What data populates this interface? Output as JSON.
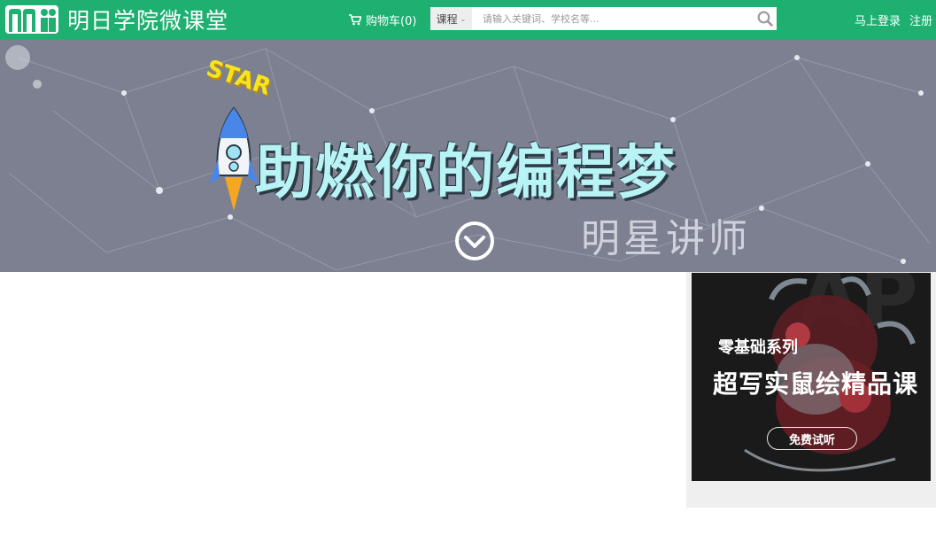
{
  "header": {
    "site_name": "明日学院微课堂",
    "cart_label": "购物车(0)",
    "search": {
      "type_label": "课程",
      "placeholder": "请输入关键词、学校名等..."
    },
    "login_label": "马上登录",
    "register_label": "注册"
  },
  "banner": {
    "star_text": "STAR",
    "title": "助燃你的编程梦",
    "subtitle": "明星讲师"
  },
  "ad": {
    "subtitle": "零基础系列",
    "title": "超写实鼠绘精品课",
    "button_label": "免费试听"
  },
  "colors": {
    "brand_green": "#1db071",
    "banner_bg": "#7c8090",
    "panel_bg": "#efefef"
  },
  "icons": [
    "logo-icon",
    "cart-icon",
    "chevron-down-icon",
    "search-icon",
    "rocket-icon",
    "circle-chevron-down-icon"
  ]
}
